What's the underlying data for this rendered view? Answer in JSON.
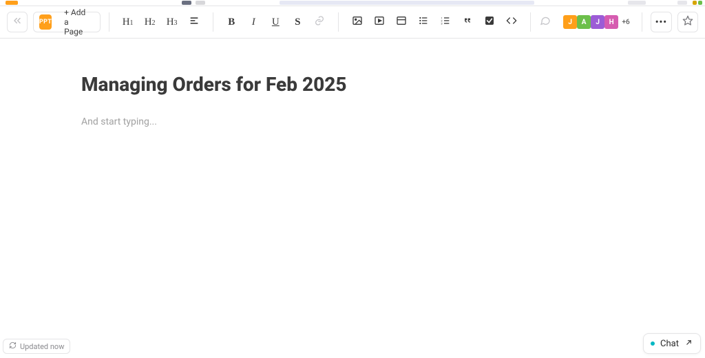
{
  "header": {
    "ppt_label": "PPT",
    "add_page_label": "+ Add a Page"
  },
  "toolbar": {
    "h1": "H",
    "h1s": "1",
    "h2": "H",
    "h2s": "2",
    "h3": "H",
    "h3s": "3",
    "bold": "B",
    "italic": "I",
    "underline": "U",
    "strike": "S"
  },
  "avatars": {
    "a0": "J",
    "a1": "A",
    "a2": "J",
    "a3": "H",
    "more": "+6"
  },
  "document": {
    "title": "Managing Orders for Feb 2025",
    "placeholder": "And start typing..."
  },
  "status": {
    "text": "Updated now"
  },
  "chat": {
    "label": "Chat"
  }
}
